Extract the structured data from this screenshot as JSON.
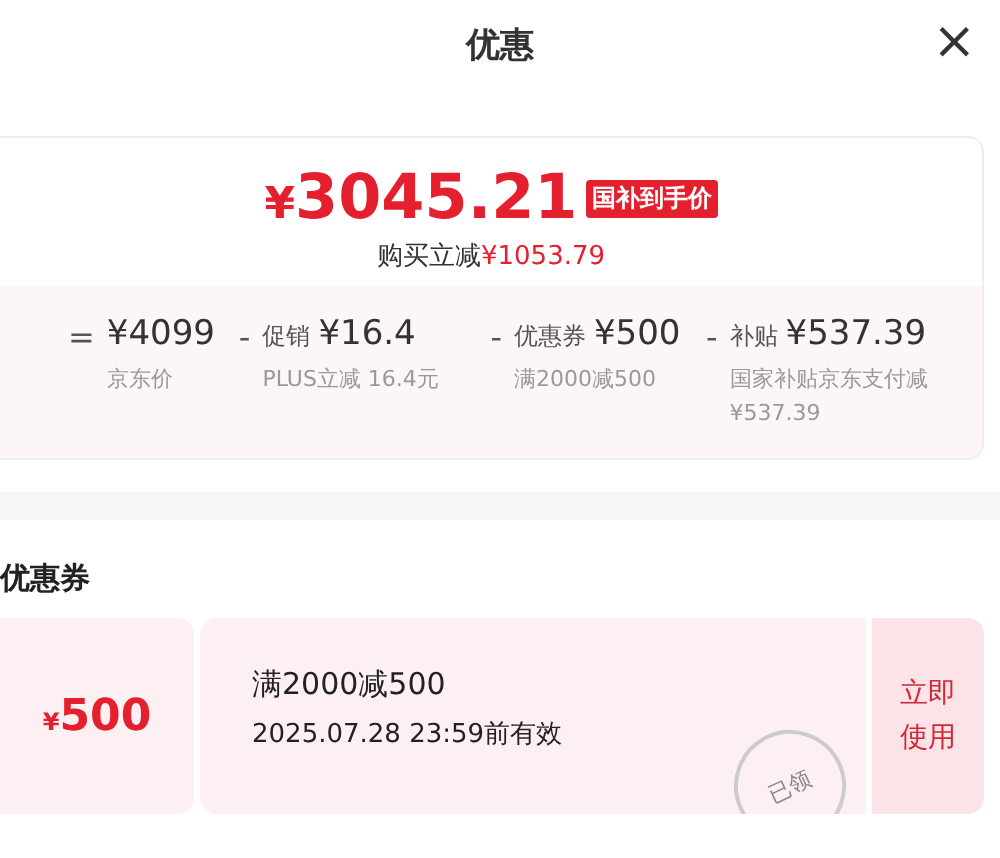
{
  "header": {
    "title": "优惠",
    "close": "×"
  },
  "summary": {
    "currency": "¥",
    "price": "3045.21",
    "badge": "国补到手价",
    "saving_label": "购买立减",
    "saving_amount": "¥1053.79"
  },
  "breakdown": [
    {
      "operator": "=",
      "amount": "¥4099",
      "note": "京东价"
    },
    {
      "operator": "-",
      "name": "促销",
      "amount": "¥16.4",
      "note": "PLUS立减 16.4元"
    },
    {
      "operator": "-",
      "name": "优惠券",
      "amount": "¥500",
      "note": "满2000减500"
    },
    {
      "operator": "-",
      "name": "补贴",
      "amount": "¥537.39",
      "note": "国家补贴京东支付减¥537.39"
    }
  ],
  "coupons_section": {
    "heading": "优惠券",
    "coupons": [
      {
        "currency": "¥",
        "amount": "500",
        "condition": "满2000减500",
        "validity": "2025.07.28 23:59前有效",
        "stamp": "已领",
        "action": "立即使用"
      }
    ]
  }
}
